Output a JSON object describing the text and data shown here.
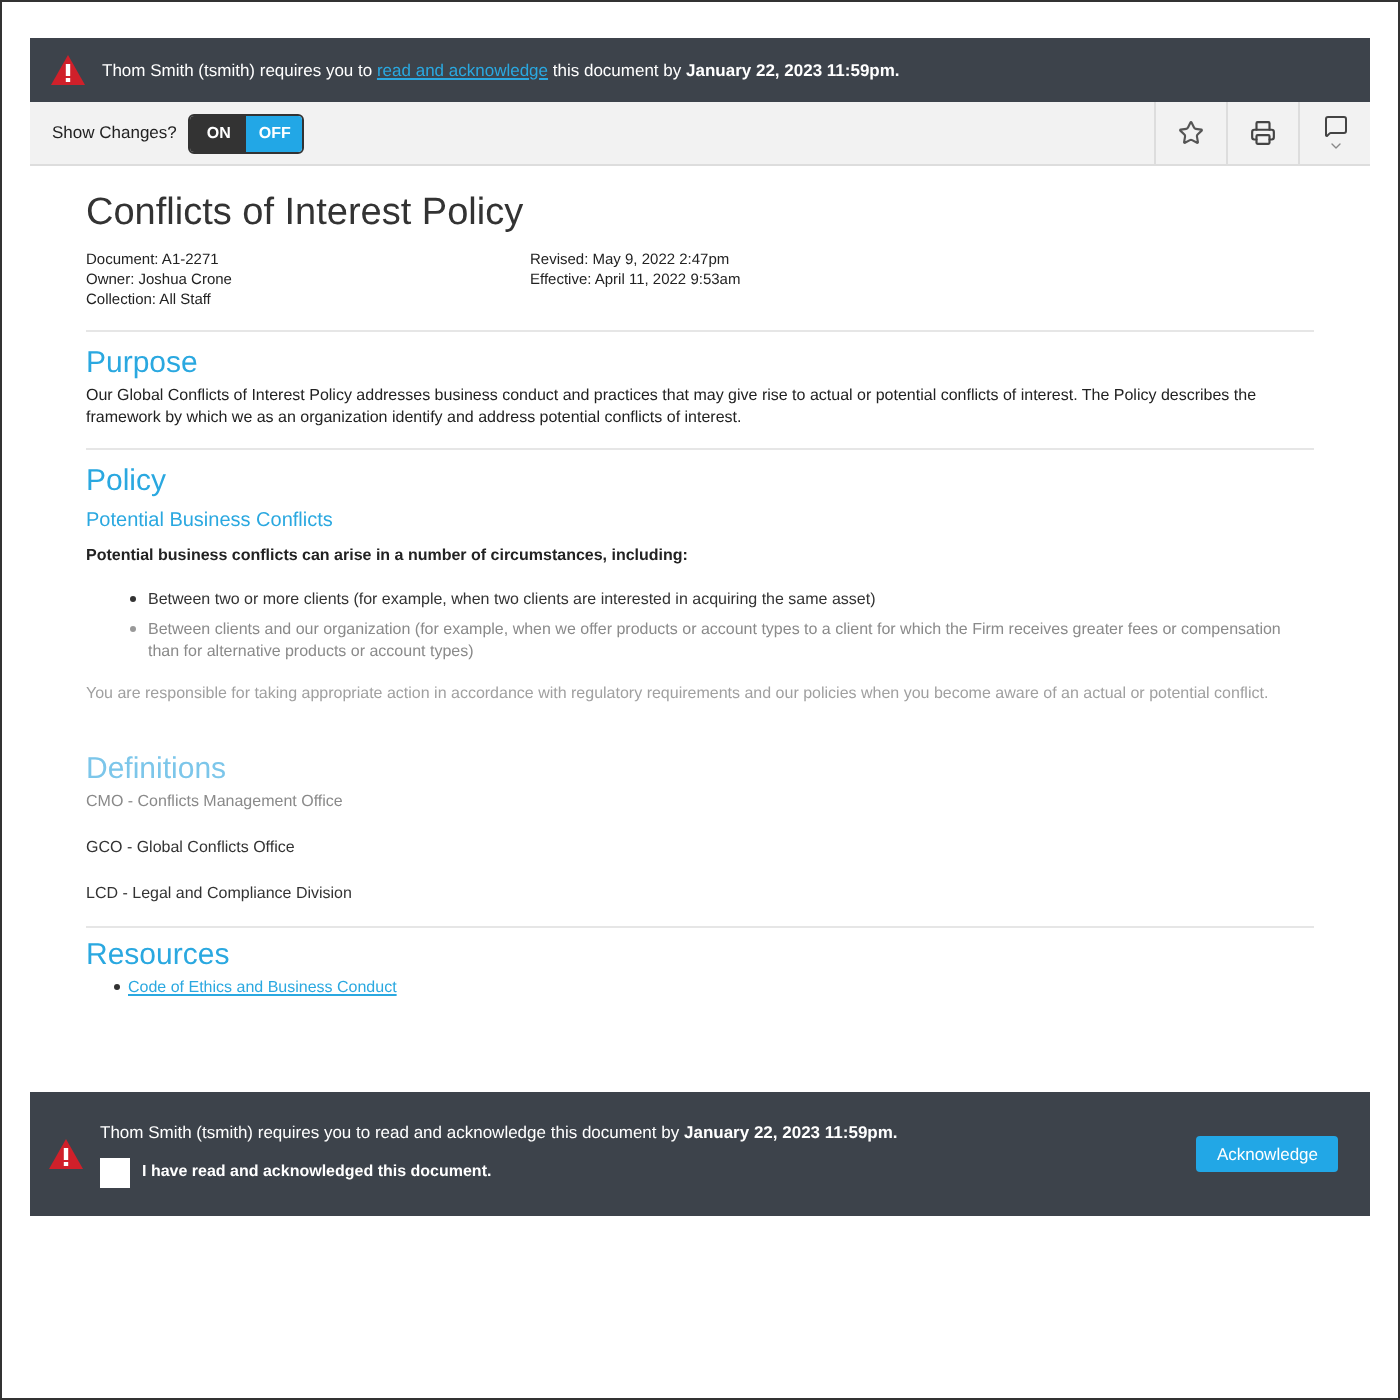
{
  "top_banner": {
    "text_before": "Thom Smith (tsmith) requires you to ",
    "link": "read and acknowledge",
    "text_after": " this document by ",
    "deadline": "January 22, 2023 11:59pm."
  },
  "toolbar": {
    "label": "Show Changes?",
    "toggle": [
      {
        "label": "ON",
        "selected": false
      },
      {
        "label": "OFF",
        "selected": true
      }
    ]
  },
  "document": {
    "title": "Conflicts of Interest Policy",
    "meta_left": [
      "Document: A1-2271",
      "Owner: Joshua Crone",
      "Collection: All Staff"
    ],
    "meta_right": [
      "Revised: May 9, 2022 2:47pm",
      "Effective: April 11, 2022 9:53am"
    ],
    "purpose": {
      "heading": "Purpose",
      "text": "Our Global Conflicts of Interest Policy addresses business conduct and practices that may give rise to actual or potential conflicts of interest. The Policy describes the framework by which we as an organization identify and address potential conflicts of interest."
    },
    "policy": {
      "heading": "Policy",
      "subheading": "Potential Business Conflicts",
      "intro": "Potential business conflicts can arise in a number of circumstances, including:",
      "bullets": [
        {
          "text": "Between two or more clients (for example, when two clients are interested in acquiring the same asset)",
          "dimmed": false
        },
        {
          "text": "Between clients and our organization (for example, when we offer products or account types to a client for which the Firm receives greater fees or compensation than for alternative products or account types)",
          "dimmed": true
        }
      ],
      "closing": {
        "text": "You are responsible for taking appropriate action in accordance with regulatory requirements and our policies when you become aware of an actual or potential conflict.",
        "dimmed": true
      }
    },
    "definitions": {
      "heading": "Definitions",
      "heading_dimmed": true,
      "items": [
        {
          "text": "CMO - Conflicts Management Office",
          "dimmed": true
        },
        {
          "text": "GCO - Global Conflicts Office",
          "dimmed": false
        },
        {
          "text": "LCD - Legal and Compliance Division",
          "dimmed": false
        }
      ]
    },
    "resources": {
      "heading": "Resources",
      "links": [
        "Code of Ethics and Business Conduct"
      ]
    }
  },
  "bottom_bar": {
    "text_before": "Thom Smith (tsmith) requires you to read and acknowledge this document by ",
    "deadline": "January 22, 2023 11:59pm.",
    "checkbox": {
      "label": "I have read and acknowledged this document.",
      "checked": false
    },
    "button": "Acknowledge"
  }
}
